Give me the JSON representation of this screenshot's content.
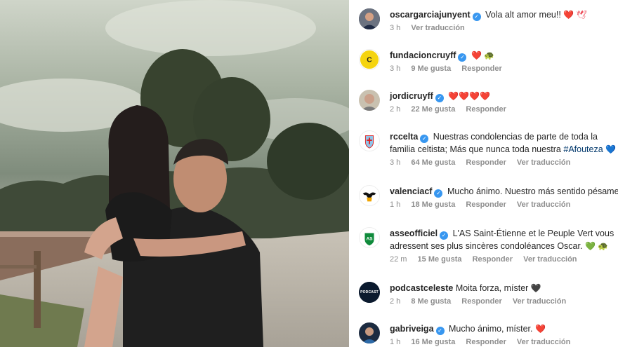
{
  "comments": [
    {
      "username": "oscargarciajunyent",
      "text": "Vola alt amor meu!!",
      "emojis": "❤️ 🕊",
      "time": "3 h",
      "likes": "",
      "reply": "",
      "translate": "Ver traducción",
      "avatar_icon": "person-photo-icon"
    },
    {
      "username": "fundacioncruyff",
      "text": "",
      "emojis": "❤️ 🐢",
      "time": "3 h",
      "likes": "9 Me gusta",
      "reply": "Responder",
      "translate": "",
      "avatar_icon": "cruyff-logo-icon"
    },
    {
      "username": "jordicruyff",
      "text": "",
      "emojis": "❤️❤️❤️❤️",
      "time": "2 h",
      "likes": "22 Me gusta",
      "reply": "Responder",
      "translate": "",
      "avatar_icon": "person-photo-icon"
    },
    {
      "username": "rccelta",
      "text": "Nuestras condolencias de parte de toda la familia celtista; Más que nunca toda nuestra",
      "hashtag": "#Afouteza",
      "emojis": "💙",
      "time": "3 h",
      "likes": "64 Me gusta",
      "reply": "Responder",
      "translate": "Ver traducción",
      "avatar_icon": "celta-crest-icon"
    },
    {
      "username": "valenciacf",
      "text": "Mucho ánimo. Nuestro más sentido pésame",
      "emojis": "",
      "time": "1 h",
      "likes": "18 Me gusta",
      "reply": "Responder",
      "translate": "Ver traducción",
      "avatar_icon": "valencia-bat-icon"
    },
    {
      "username": "asseofficiel",
      "text": "L'AS Saint-Étienne et le Peuple Vert vous adressent ses plus sincères condoléances Oscar.",
      "emojis": "💚 🐢",
      "time": "22 m",
      "likes": "15 Me gusta",
      "reply": "Responder",
      "translate": "Ver traducción",
      "avatar_icon": "asse-crest-icon"
    },
    {
      "username": "podcastceleste",
      "text": "Moita forza, míster",
      "emojis": "🖤",
      "time": "2 h",
      "likes": "8 Me gusta",
      "reply": "Responder",
      "translate": "Ver traducción",
      "avatar_icon": "podcast-logo-icon",
      "avatar_text": "PODCAST"
    },
    {
      "username": "gabriveiga",
      "text": "Mucho ánimo, míster.",
      "emojis": "❤️",
      "time": "1 h",
      "likes": "16 Me gusta",
      "reply": "Responder",
      "translate": "Ver traducción",
      "avatar_icon": "person-photo-icon"
    }
  ],
  "colors": {
    "verified": "#3897f0",
    "meta": "#8e8e8e",
    "text": "#262626",
    "heart_red": "#ed1c24",
    "heart_blue": "#3b82f6",
    "heart_green": "#34c759"
  }
}
